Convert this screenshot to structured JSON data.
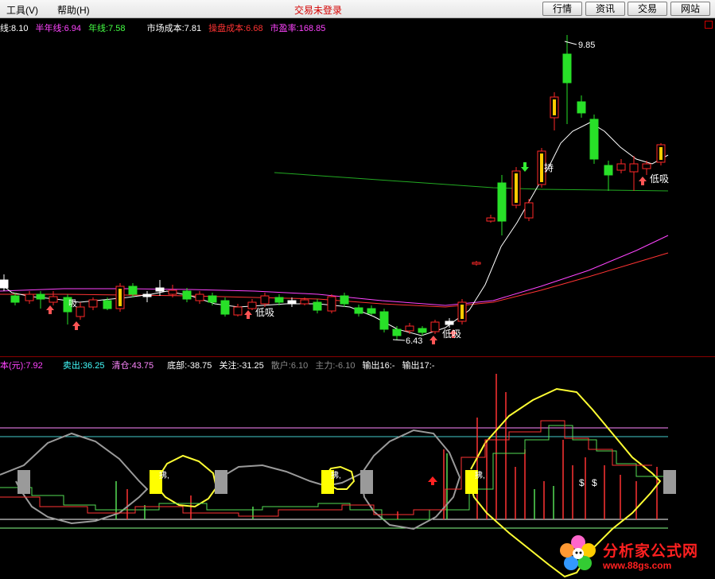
{
  "menu": {
    "tools": "工具(V)",
    "help": "帮助(H)",
    "status": "交易未登录",
    "buttons": [
      "行情",
      "资讯",
      "交易",
      "网站"
    ]
  },
  "price_panel": {
    "indicators": [
      {
        "label": "线:8.10",
        "color": "#ffffff"
      },
      {
        "label": "半年线:6.94",
        "color": "#ff44ff"
      },
      {
        "label": "年线:7.58",
        "color": "#44ff44"
      },
      {
        "label": "市场成本:7.81",
        "color": "#ffffff"
      },
      {
        "label": "操盘成本:6.68",
        "color": "#ff3333"
      },
      {
        "label": "市盈率:168.85",
        "color": "#ff44ff"
      }
    ],
    "annotations": {
      "high_price": "9.85",
      "low_price": "6.43",
      "buy_low": "低吸",
      "buy_low_short": "吸",
      "hold": "持"
    }
  },
  "sub_panel": {
    "indicators": [
      {
        "label": "本(元):7.92",
        "color": "#ff44ff"
      },
      {
        "label": "卖出:36.25",
        "color": "#44ffff"
      },
      {
        "label": "清仓:43.75",
        "color": "#ff88ff"
      },
      {
        "label": "底部:-38.75",
        "color": "#ffffff"
      },
      {
        "label": "关注:-31.25",
        "color": "#ffffff"
      },
      {
        "label": "散户:6.10",
        "color": "#888888"
      },
      {
        "label": "主力:-6.10",
        "color": "#888888"
      },
      {
        "label": "输出16:-",
        "color": "#ffffff"
      },
      {
        "label": "输出17:-",
        "color": "#ffffff"
      }
    ],
    "signal_label": "拂,",
    "dollar": "$"
  },
  "watermark": {
    "title": "分析家公式网",
    "url": "www.88gs.com"
  },
  "colors": {
    "up": "#ff2828",
    "down": "#28e028",
    "ma_white": "#ffffff",
    "ma_magenta": "#ff44ff",
    "ma_red": "#ff3333",
    "cost_green": "#22aa22"
  }
}
